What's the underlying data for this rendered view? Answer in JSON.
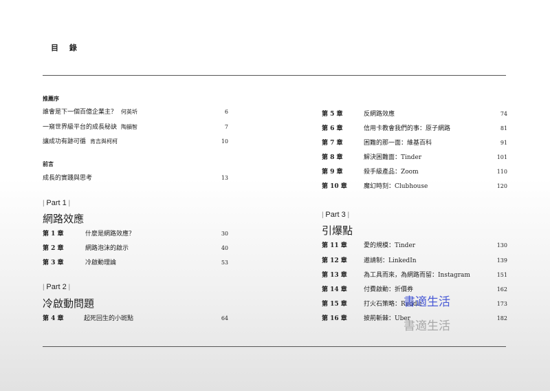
{
  "title": "目 錄",
  "left": {
    "recommend": {
      "heading": "推薦序",
      "items": [
        {
          "text": "誰會是下一個百億企業主？",
          "author": "何英圻",
          "page": "6"
        },
        {
          "text": "一窺世界級平台的成長秘訣",
          "author": "陶韻智",
          "page": "7"
        },
        {
          "text": "讓成功有跡可循",
          "author": "肯吉與柯柯",
          "page": "10"
        }
      ]
    },
    "preface": {
      "heading": "前言",
      "items": [
        {
          "text": "成長的實踐與思考",
          "page": "13"
        }
      ]
    },
    "part1": {
      "label": "Part 1",
      "title": "網路效應",
      "chapters": [
        {
          "num": "第 1 章",
          "title": "什麼是網路效應？",
          "page": "30"
        },
        {
          "num": "第 2 章",
          "title": "網路泡沫的啟示",
          "page": "40"
        },
        {
          "num": "第 3 章",
          "title": "冷啟動理論",
          "page": "53"
        }
      ]
    },
    "part2": {
      "label": "Part 2",
      "title": "冷啟動問題",
      "chapters": [
        {
          "num": "第 4 章",
          "title": "起死回生的小斑點",
          "page": "64"
        }
      ]
    }
  },
  "right": {
    "cont": {
      "chapters": [
        {
          "num": "第 5 章",
          "title": "反網路效應",
          "page": "74"
        },
        {
          "num": "第 6 章",
          "title": "信用卡教會我們的事：原子網路",
          "page": "81"
        },
        {
          "num": "第 7 章",
          "title": "困難的那一面：維基百科",
          "page": "91"
        },
        {
          "num": "第 8 章",
          "title": "解決困難面：Tinder",
          "page": "101"
        },
        {
          "num": "第 9 章",
          "title": "殺手級產品：Zoom",
          "page": "110"
        },
        {
          "num": "第 10 章",
          "title": "魔幻時刻：Clubhouse",
          "page": "120"
        }
      ]
    },
    "part3": {
      "label": "Part 3",
      "title": "引爆點",
      "chapters": [
        {
          "num": "第 11 章",
          "title": "愛的規模：Tinder",
          "page": "130"
        },
        {
          "num": "第 12 章",
          "title": "邀請制：LinkedIn",
          "page": "139"
        },
        {
          "num": "第 13 章",
          "title": "為工具而來，為網路而留：Instagram",
          "page": "151"
        },
        {
          "num": "第 14 章",
          "title": "付費啟動：折價券",
          "page": "162"
        },
        {
          "num": "第 15 章",
          "title": "打火石策略：Reddit",
          "page": "173"
        },
        {
          "num": "第 16 章",
          "title": "披荊斬棘：Uber",
          "page": "182"
        }
      ]
    }
  },
  "watermark": {
    "blue": "書適生活",
    "gray": "書適生活"
  },
  "colors": {
    "text": "#222222",
    "rule": "#555555",
    "watermark_blue": "#4a5bd6",
    "watermark_gray": "#a8a8a8"
  }
}
